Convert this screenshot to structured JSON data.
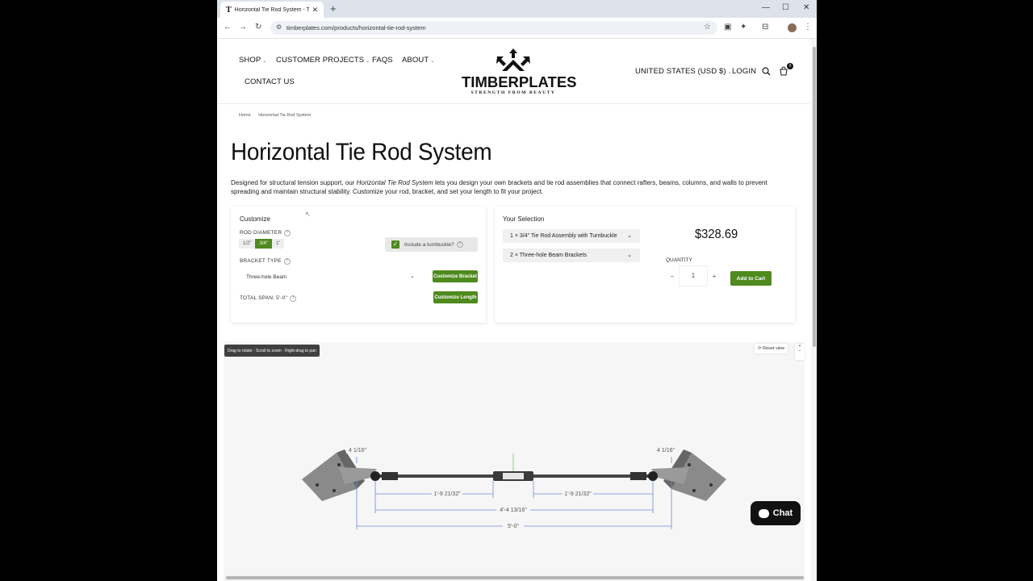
{
  "browser": {
    "tab_title": "Horizontal Tie Rod System - Ti",
    "tab_favicon": "T",
    "url": "timberplates.com/products/horizontal-tie-rod-system"
  },
  "nav": {
    "shop": "SHOP",
    "customer_projects": "CUSTOMER PROJECTS",
    "faqs": "FAQS",
    "about": "ABOUT",
    "contact": "CONTACT US",
    "currency": "UNITED STATES (USD $)",
    "login": "LOGIN",
    "cart_count": "0"
  },
  "logo": {
    "name": "TIMBERPLATES",
    "tagline": "STRENGTH FROM BEAUTY"
  },
  "breadcrumbs": [
    "Home",
    "Horizontal Tie Rod System"
  ],
  "product": {
    "title": "Horizontal Tie Rod System",
    "desc_before": "Designed for structural tension support, our ",
    "desc_em": "Horizontal Tie Rod System",
    "desc_after": " lets you design your own brackets and tie rod assemblies that connect rafters, beams, columns, and walls to prevent spreading and maintain structural stability. Customize your rod, bracket, and set your length to fit your project."
  },
  "customize": {
    "title": "Customize",
    "rod_diameter_label": "ROD DIAMETER",
    "rod_options": [
      "1/2\"",
      "3/4\"",
      "1\""
    ],
    "rod_selected": "3/4\"",
    "turnbuckle_label": "Include a turnbuckle?",
    "turnbuckle_checked": true,
    "bracket_type_label": "BRACKET TYPE",
    "bracket_type_value": "Three-hole Beam",
    "customize_bracket": "Customize Bracket",
    "total_span_label": "TOTAL SPAN: 5'-0\"",
    "customize_length": "Customize Length"
  },
  "selection": {
    "title": "Your Selection",
    "item1": "1 × 3/4\" Tie Rod Assembly with Turnbuckle",
    "item2": "2 × Three-hole Beam Brackets",
    "price": "$328.69",
    "quantity_label": "QUANTITY",
    "quantity": "1",
    "minus": "−",
    "plus": "+",
    "add_to_cart": "Add to Cart"
  },
  "viewer": {
    "hint": "Drag to rotate · Scroll to zoom · Right-drag to pan",
    "reset": "⟳ Reset view",
    "zoom_in": "+",
    "zoom_out": "−",
    "dims": {
      "left_top": "4 1/16\"",
      "right_top": "4 1/16\"",
      "left_seg": "1'-9 21/32\"",
      "right_seg": "1'-9 21/32\"",
      "mid": "4'-4 13/16\"",
      "total": "5'-0\""
    },
    "dim_color": "#6a8ed8"
  },
  "chat": {
    "label": "Chat"
  },
  "colors": {
    "accent_green": "#4e8a1e"
  }
}
